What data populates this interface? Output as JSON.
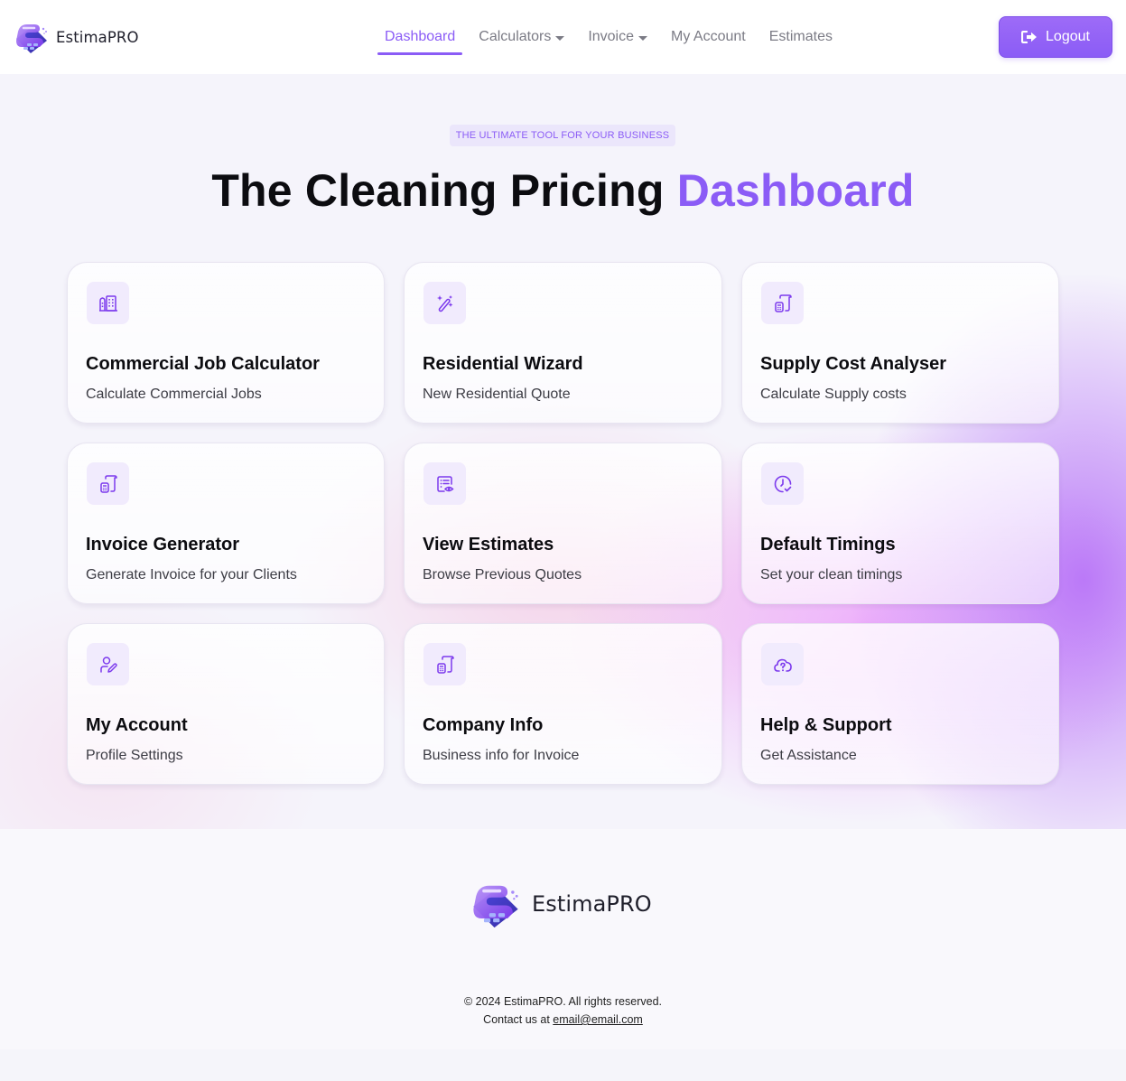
{
  "header": {
    "brand_name": "EstimaPRO",
    "nav": [
      {
        "label": "Dashboard",
        "active": true,
        "dropdown": false
      },
      {
        "label": "Calculators",
        "active": false,
        "dropdown": true
      },
      {
        "label": "Invoice",
        "active": false,
        "dropdown": true
      },
      {
        "label": "My Account",
        "active": false,
        "dropdown": false
      },
      {
        "label": "Estimates",
        "active": false,
        "dropdown": false
      }
    ],
    "logout_label": "Logout",
    "logout_icon": "sign-out-icon"
  },
  "hero": {
    "tagline": "THE ULTIMATE TOOL FOR YOUR BUSINESS",
    "title_main": "The Cleaning Pricing ",
    "title_accent": "Dashboard"
  },
  "cards": [
    {
      "title": "Commercial Job Calculator",
      "description": "Calculate Commercial Jobs",
      "icon": "buildings-icon"
    },
    {
      "title": "Residential Wizard",
      "description": "New Residential Quote",
      "icon": "magic-wand-icon"
    },
    {
      "title": "Supply Cost Analyser",
      "description": "Calculate Supply costs",
      "icon": "calculator-receipt-icon"
    },
    {
      "title": "Invoice Generator",
      "description": "Generate Invoice for your Clients",
      "icon": "calculator-receipt-icon"
    },
    {
      "title": "View Estimates",
      "description": "Browse Previous Quotes",
      "icon": "list-view-icon"
    },
    {
      "title": "Default Timings",
      "description": "Set your clean timings",
      "icon": "clock-check-icon"
    },
    {
      "title": "My Account",
      "description": "Profile Settings",
      "icon": "user-edit-icon"
    },
    {
      "title": "Company Info",
      "description": "Business info for Invoice",
      "icon": "calculator-receipt-icon"
    },
    {
      "title": "Help & Support",
      "description": "Get Assistance",
      "icon": "cloud-question-icon"
    }
  ],
  "footer": {
    "brand_name": "EstimaPRO",
    "copyright": "© 2024 EstimaPRO. All rights reserved.",
    "contact_prefix": "Contact us at ",
    "contact_email": "email@email.com"
  },
  "colors": {
    "accent": "#8b5cf6",
    "icon_bg": "#f1ebfd",
    "text_dark": "#0c0c10",
    "nav_text": "#7b7b85"
  }
}
